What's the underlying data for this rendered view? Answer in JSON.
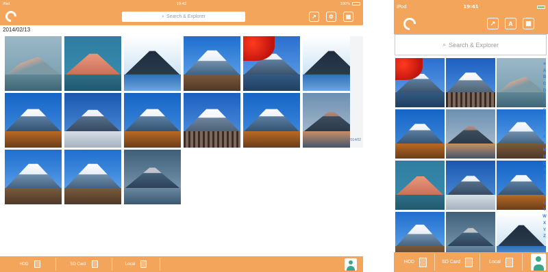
{
  "ipad": {
    "status": {
      "carrier": "iPad",
      "time": "19:42",
      "battery": "100%"
    },
    "search_placeholder": "Search & Explorer",
    "date_header": "2014/02/13",
    "side_label": "2014/02",
    "photos": [
      "dawn",
      "pink",
      "blue",
      "snow",
      "maple",
      "blue",
      "autumn",
      "frost",
      "autumn",
      "trees",
      "autumn",
      "sunset",
      "snow",
      "snow",
      "lake"
    ],
    "tabs": [
      {
        "label": "HDD"
      },
      {
        "label": "SD Card"
      },
      {
        "label": "Local"
      }
    ]
  },
  "iphone": {
    "status": {
      "carrier": "iPod",
      "time": "19:41"
    },
    "search_placeholder": "Search & Explorer",
    "nav_letter_button": "A",
    "alphabet": [
      "#",
      "A",
      "B",
      "C",
      "D",
      "E",
      "F",
      "G",
      "H",
      "I",
      "J",
      "K",
      "L",
      "M",
      "N",
      "O",
      "P",
      "Q",
      "R",
      "S",
      "T",
      "U",
      "V",
      "W",
      "X",
      "Y",
      "Z"
    ],
    "photos": [
      "maple",
      "trees",
      "dawn",
      "autumn",
      "sunset",
      "snow",
      "pink",
      "frost",
      "autumn",
      "snow",
      "lake",
      "blue"
    ],
    "tabs": [
      {
        "label": "HDD"
      },
      {
        "label": "SD Card"
      },
      {
        "label": "Local"
      }
    ]
  },
  "colors": {
    "accent": "#f4a55c",
    "index_blue": "#3b7bd6",
    "avatar_green": "#39a88a"
  },
  "icons": {
    "logo": "refresh-logo-icon",
    "share": "share-icon",
    "settings": "gear-icon",
    "grid": "grid-icon",
    "search": "search-icon",
    "user": "user-icon"
  }
}
